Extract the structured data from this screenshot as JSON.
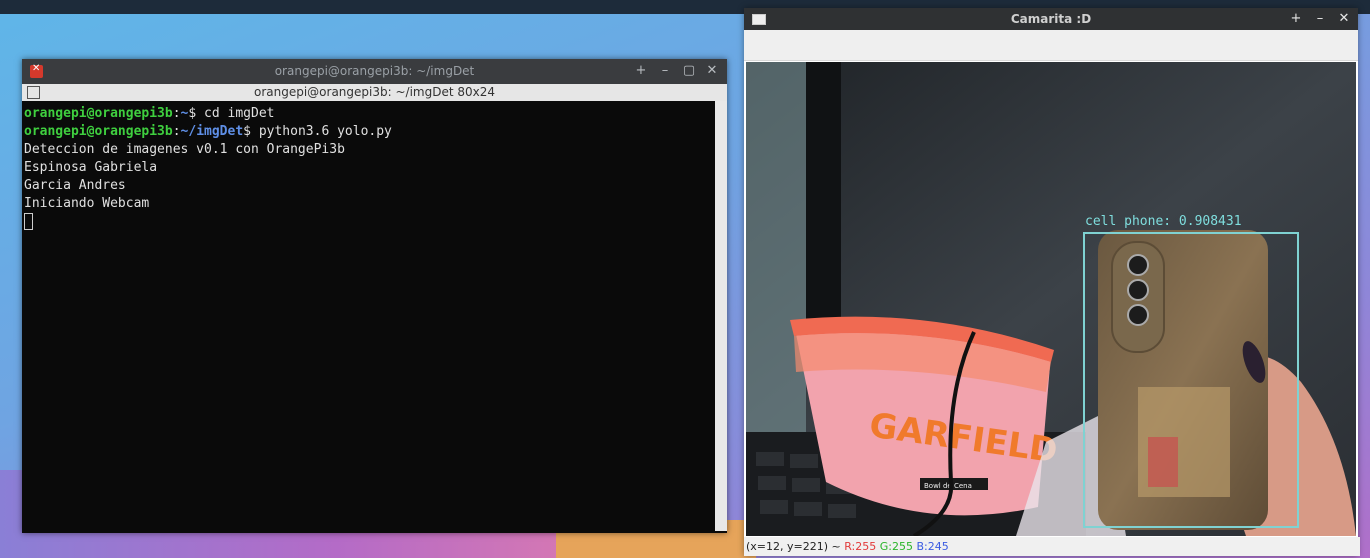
{
  "terminal": {
    "window_title": "orangepi@orangepi3b: ~/imgDet",
    "tab_title": "orangepi@orangepi3b: ~/imgDet 80x24",
    "controls": {
      "add": "+",
      "minimize": "–",
      "maximize": "▢",
      "close": "✕"
    },
    "lines": [
      {
        "user": "orangepi@orangepi3b",
        "sep": ":",
        "path": "~",
        "cmd": "$ cd imgDet"
      },
      {
        "user": "orangepi@orangepi3b",
        "sep": ":",
        "path": "~/imgDet",
        "cmd": "$ python3.6 yolo.py"
      },
      {
        "text": "Deteccion de imagenes v0.1 con OrangePi3b"
      },
      {
        "text": "Espinosa Gabriela"
      },
      {
        "text": "Garcia Andres"
      },
      {
        "text": "Iniciando Webcam"
      }
    ]
  },
  "camera": {
    "window_title": "Camarita :D",
    "controls": {
      "add": "+",
      "minimize": "–",
      "close": "✕"
    },
    "detection": {
      "label": "cell phone: 0.908431",
      "box_color": "#7fd2d2"
    },
    "status": {
      "coords": "(x=12, y=221) ~ ",
      "r": "R:255",
      "g": "G:255",
      "b": "B:245"
    },
    "scene_text": {
      "brand": "GARFIELD",
      "tag": "Bowl de Cena"
    }
  }
}
